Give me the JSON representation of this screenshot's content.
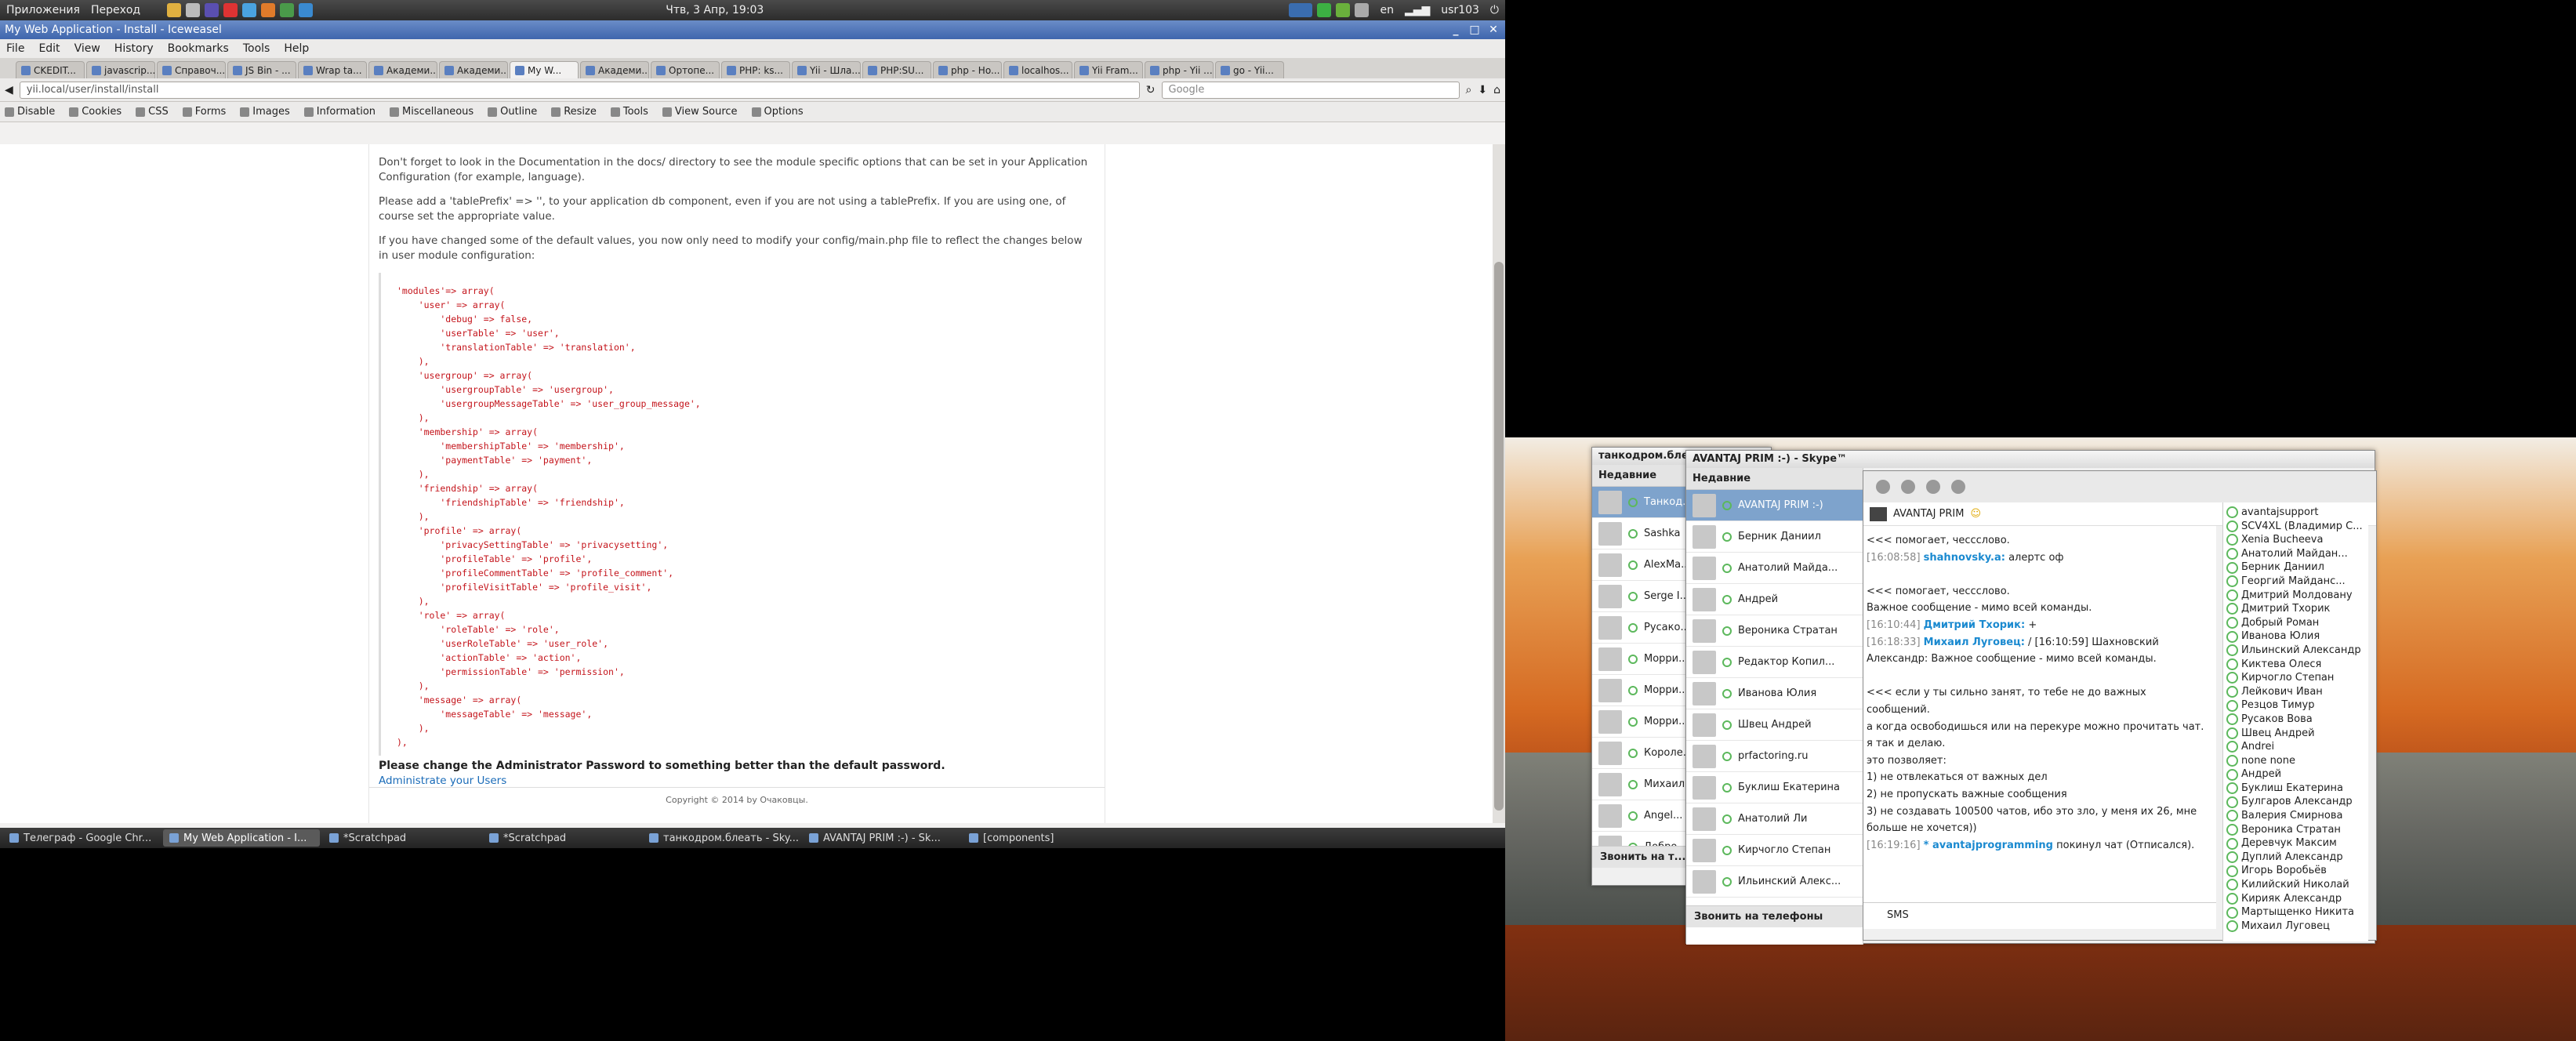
{
  "top_panel": {
    "apps": "Приложения",
    "places": "Переход",
    "clock": "Чтв, 3 Апр, 19:03",
    "lang": "en",
    "user": "usr103"
  },
  "browser": {
    "title": "My Web Application - Install - Iceweasel",
    "menu": [
      "File",
      "Edit",
      "View",
      "History",
      "Bookmarks",
      "Tools",
      "Help"
    ],
    "tabs": [
      "CKEDIT...",
      "javascrip...",
      "Справоч...",
      "JS Bin - ...",
      "Wrap ta...",
      "Академи...",
      "Академи...",
      "My W...",
      "Академи...",
      "Ортопе...",
      "PHP: ks...",
      "Yii - Шла...",
      "PHP:SU...",
      "php - Ho...",
      "localhos...",
      "Yii Fram...",
      "php - Yii ...",
      "go - Yii..."
    ],
    "active_tab": 7,
    "url": "yii.local/user/install/install",
    "search_placeholder": "Google",
    "devbar": [
      "Disable",
      "Cookies",
      "CSS",
      "Forms",
      "Images",
      "Information",
      "Miscellaneous",
      "Outline",
      "Resize",
      "Tools",
      "View Source",
      "Options"
    ]
  },
  "page": {
    "p1": "Don't forget to look in the Documentation in the docs/ directory to see the module specific options that can be set in your Application Configuration (for example, language).",
    "p2": "Please add a 'tablePrefix' => '', to your application db component, even if you are not using a tablePrefix. If you are using one, of course set the appropriate value.",
    "p3": "If you have changed some of the default values, you now only need to modify your config/main.php file to reflect the changes below in user module configuration:",
    "code": "'modules'=> array(\n    'user' => array(\n        'debug' => false,\n        'userTable' => 'user',\n        'translationTable' => 'translation',\n    ),\n    'usergroup' => array(\n        'usergroupTable' => 'usergroup',\n        'usergroupMessageTable' => 'user_group_message',\n    ),\n    'membership' => array(\n        'membershipTable' => 'membership',\n        'paymentTable' => 'payment',\n    ),\n    'friendship' => array(\n        'friendshipTable' => 'friendship',\n    ),\n    'profile' => array(\n        'privacySettingTable' => 'privacysetting',\n        'profileTable' => 'profile',\n        'profileCommentTable' => 'profile_comment',\n        'profileVisitTable' => 'profile_visit',\n    ),\n    'role' => array(\n        'roleTable' => 'role',\n        'userRoleTable' => 'user_role',\n        'actionTable' => 'action',\n        'permissionTable' => 'permission',\n    ),\n    'message' => array(\n        'messageTable' => 'message',\n    ),\n),",
    "warning": "Please change the Administrator Password to something better than the default password.",
    "admin_link": "Administrate your Users",
    "copyright": "Copyright © 2014 by Очаковцы."
  },
  "taskbar": [
    "Телеграф - Google Chr...",
    "My Web Application - I...",
    "*Scratchpad",
    "*Scratchpad",
    "танкодром.блеать - Sky...",
    "AVANTAJ PRIM :-) - Sk...",
    "[components]"
  ],
  "skype_back": {
    "title": "танкодром.блеать",
    "recent": "Недавние",
    "contacts": [
      "Танкод...",
      "Sashka",
      "AlexMa...",
      "Serge I...",
      "Русако...",
      "Морри...",
      "Морри...",
      "Морри...",
      "Короле...",
      "Михаил...",
      "Angel...",
      "Добро..."
    ],
    "call": "Звонить на т..."
  },
  "skype_front": {
    "title": "AVANTAJ PRIM :-) - Skype™",
    "recent": "Недавние",
    "contacts": [
      "AVANTAJ PRIM :-)",
      "Берник Даниил",
      "Анатолий Майда...",
      "Андрей",
      "Вероника Стратан",
      "Редактор Копил...",
      "Иванова Юлия",
      "Швец Андрей",
      "prfactoring.ru",
      "Буклиш Екатерина",
      "Анатолий Ли",
      "Кирчогло Степан",
      "Ильинский Алекс..."
    ],
    "call": "Звонить на телефоны"
  },
  "chat": {
    "conv_name": "AVANTAJ PRIM",
    "messages": [
      {
        "ts": "",
        "who": "",
        "text": "<<< помогает, чессслово."
      },
      {
        "ts": "[16:08:58]",
        "who": "shahnovsky.a:",
        "text": "алертс оф"
      },
      {
        "ts": "",
        "who": "",
        "text": ""
      },
      {
        "ts": "",
        "who": "",
        "text": "<<< помогает, чессслово."
      },
      {
        "ts": "",
        "who": "",
        "text": "Важное сообщение - мимо всей команды."
      },
      {
        "ts": "[16:10:44]",
        "who": "Дмитрий Тхорик:",
        "text": "+"
      },
      {
        "ts": "[16:18:33]",
        "who": "Михаил Луговец:",
        "text": "/ [16:10:59] Шахновский"
      },
      {
        "ts": "",
        "who": "",
        "text": "Александр: Важное сообщение - мимо всей команды."
      },
      {
        "ts": "",
        "who": "",
        "text": ""
      },
      {
        "ts": "",
        "who": "",
        "text": "<<< если у ты сильно занят, то тебе не до важных"
      },
      {
        "ts": "",
        "who": "",
        "text": "сообщений."
      },
      {
        "ts": "",
        "who": "",
        "text": "а когда освободишься или на перекуре можно прочитать чат."
      },
      {
        "ts": "",
        "who": "",
        "text": "я так и делаю."
      },
      {
        "ts": "",
        "who": "",
        "text": "это позволяет:"
      },
      {
        "ts": "",
        "who": "",
        "text": "1) не отвлекаться от важных дел"
      },
      {
        "ts": "",
        "who": "",
        "text": "2) не пропускать важные сообщения"
      },
      {
        "ts": "",
        "who": "",
        "text": "3) не создавать 100500 чатов, ибо это зло, у меня их 26, мне"
      },
      {
        "ts": "",
        "who": "",
        "text": "больше не хочется))"
      },
      {
        "ts": "[16:19:16]",
        "who": "* avantajprogramming",
        "text": "покинул чат (Отписался)."
      }
    ],
    "input_placeholder": "SMS",
    "members": [
      "avantajsupport",
      "SCV4XL (Владимир С...",
      "Xenia Bucheeva",
      "Анатолий Майдан...",
      "Берник Даниил",
      "Георгий Майданс...",
      "Дмитрий Молдовану",
      "Дмитрий Тхорик",
      "Добрый Роман",
      "Иванова Юлия",
      "Ильинский Александр",
      "Киктева Олеся",
      "Кирчогло Степан",
      "Лейкович Иван",
      "Резцов Тимур",
      "Русаков Вова",
      "Швец Андрей",
      "Andrei",
      "none none",
      "Андрей",
      "Буклиш Екатерина",
      "Булгаров Александр",
      "Валерия Смирнова",
      "Вероника Стратан",
      "Деревчук Максим",
      "Дуплий Александр",
      "Игорь Воробьёв",
      "Килийский Николай",
      "Кирияк Александр",
      "Мартыщенко Никита",
      "Михаил Луговец"
    ]
  }
}
